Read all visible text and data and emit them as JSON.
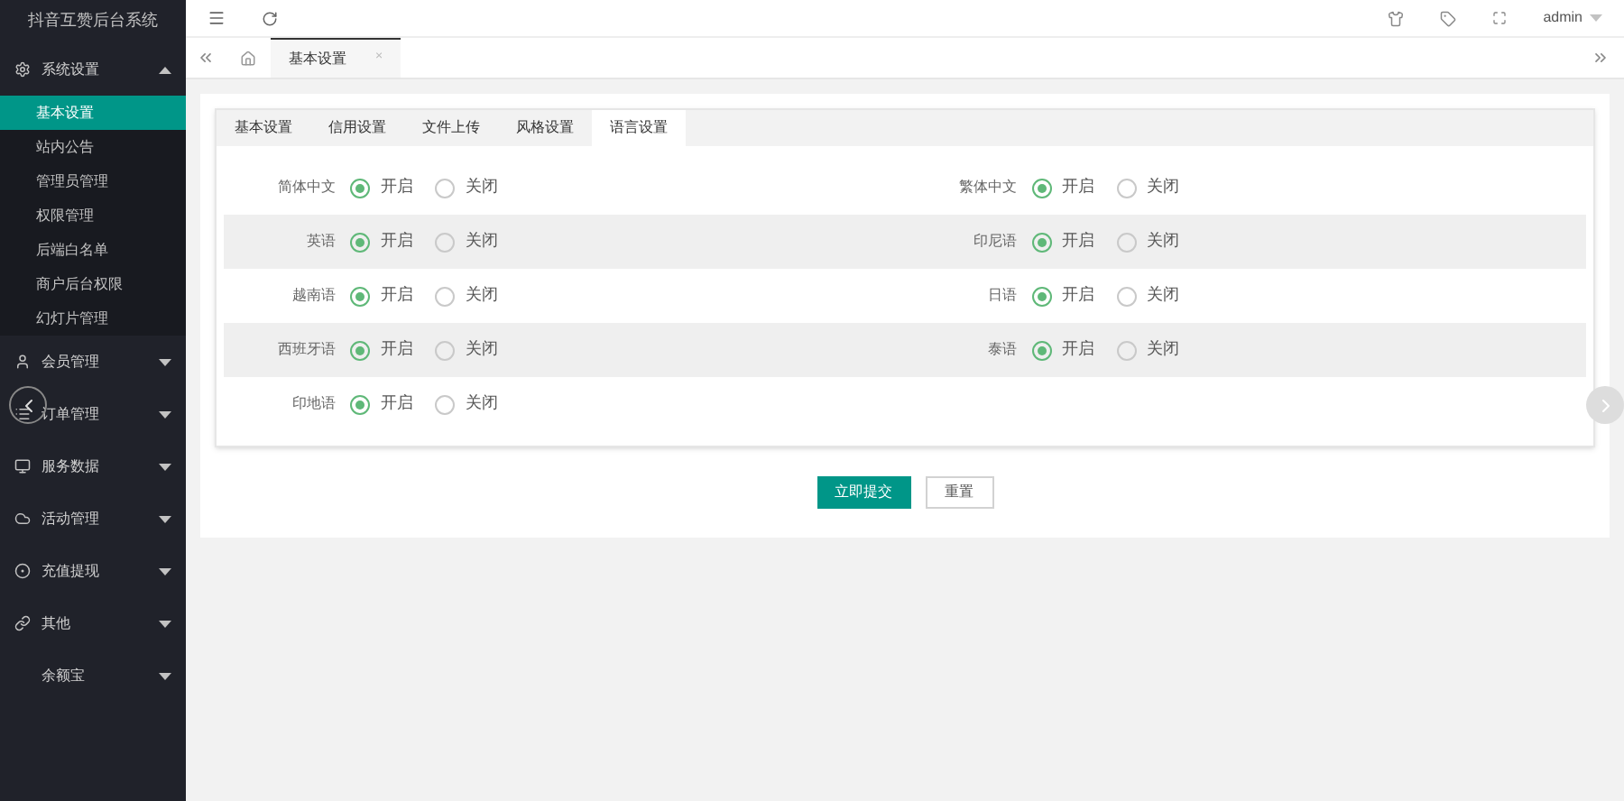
{
  "sidebar": {
    "title": "抖音互赞后台系统",
    "groups": [
      {
        "label": "系统设置",
        "expanded": true,
        "items": [
          {
            "label": "基本设置",
            "selected": true
          },
          {
            "label": "站内公告",
            "selected": false
          },
          {
            "label": "管理员管理",
            "selected": false
          },
          {
            "label": "权限管理",
            "selected": false
          },
          {
            "label": "后端白名单",
            "selected": false
          },
          {
            "label": "商户后台权限",
            "selected": false
          },
          {
            "label": "幻灯片管理",
            "selected": false
          }
        ]
      },
      {
        "label": "会员管理",
        "expanded": false
      },
      {
        "label": "订单管理",
        "expanded": false
      },
      {
        "label": "服务数据",
        "expanded": false
      },
      {
        "label": "活动管理",
        "expanded": false
      },
      {
        "label": "充值提现",
        "expanded": false
      },
      {
        "label": "其他",
        "expanded": false
      },
      {
        "label": "余额宝",
        "expanded": false
      }
    ]
  },
  "header": {
    "user": "admin"
  },
  "page_tabs": [
    {
      "label": "基本设置",
      "close": "×",
      "selected": true
    }
  ],
  "form_tabs": [
    {
      "label": "基本设置",
      "selected": false
    },
    {
      "label": "信用设置",
      "selected": false
    },
    {
      "label": "文件上传",
      "selected": false
    },
    {
      "label": "风格设置",
      "selected": false
    },
    {
      "label": "语言设置",
      "selected": true
    }
  ],
  "rows": [
    [
      {
        "label": "简体中文",
        "options": [
          {
            "label": "开启",
            "selected": true
          },
          {
            "label": "关闭",
            "selected": false
          }
        ]
      },
      {
        "label": "繁体中文",
        "options": [
          {
            "label": "开启",
            "selected": true
          },
          {
            "label": "关闭",
            "selected": false
          }
        ]
      }
    ],
    [
      {
        "label": "英语",
        "options": [
          {
            "label": "开启",
            "selected": true
          },
          {
            "label": "关闭",
            "selected": false
          }
        ]
      },
      {
        "label": "印尼语",
        "options": [
          {
            "label": "开启",
            "selected": true
          },
          {
            "label": "关闭",
            "selected": false
          }
        ]
      }
    ],
    [
      {
        "label": "越南语",
        "options": [
          {
            "label": "开启",
            "selected": true
          },
          {
            "label": "关闭",
            "selected": false
          }
        ]
      },
      {
        "label": "日语",
        "options": [
          {
            "label": "开启",
            "selected": true
          },
          {
            "label": "关闭",
            "selected": false
          }
        ]
      }
    ],
    [
      {
        "label": "西班牙语",
        "options": [
          {
            "label": "开启",
            "selected": true
          },
          {
            "label": "关闭",
            "selected": false
          }
        ]
      },
      {
        "label": "泰语",
        "options": [
          {
            "label": "开启",
            "selected": true
          },
          {
            "label": "关闭",
            "selected": false
          }
        ]
      }
    ],
    [
      {
        "label": "印地语",
        "options": [
          {
            "label": "开启",
            "selected": true
          },
          {
            "label": "关闭",
            "selected": false
          }
        ]
      }
    ]
  ],
  "buttons": [
    {
      "label": "立即提交",
      "kind": "primary"
    },
    {
      "label": "重置",
      "kind": "plain"
    }
  ]
}
